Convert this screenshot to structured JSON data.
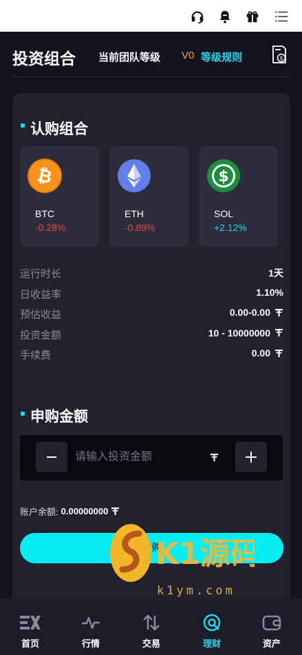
{
  "header": {
    "title": "投资组合",
    "level_label": "当前团队等级",
    "level_value": "V0",
    "rules_link": "等级规则"
  },
  "subscribe": {
    "section_title": "认购组合",
    "coins": [
      {
        "name": "BTC",
        "change": "-0.28%",
        "icon": "bitcoin-icon"
      },
      {
        "name": "ETH",
        "change": "-0.89%",
        "icon": "ethereum-icon"
      },
      {
        "name": "SOL",
        "change": "+2.12%",
        "icon": "dollar-coin-icon"
      }
    ]
  },
  "details": [
    {
      "label": "运行时长",
      "value": "1天",
      "unit_icon": false
    },
    {
      "label": "日收益率",
      "value": "1.10%",
      "unit_icon": false
    },
    {
      "label": "预估收益",
      "value": "0.00-0.00",
      "unit_icon": true
    },
    {
      "label": "投资金额",
      "value": "10 - 10000000",
      "unit_icon": true
    },
    {
      "label": "手续费",
      "value": "0.00",
      "unit_icon": true
    }
  ],
  "purchase": {
    "section_title": "申购金额",
    "input_placeholder": "请输入投资金额",
    "balance_label": "账户余额:",
    "balance_value": "0.00000000",
    "buy_label": "申购"
  },
  "watermark": {
    "brand": "K1源码",
    "domain": "k1ym.com"
  },
  "tabs": [
    {
      "label": "首页",
      "icon": "ex-logo-icon",
      "active": false
    },
    {
      "label": "行情",
      "icon": "pulse-icon",
      "active": false
    },
    {
      "label": "交易",
      "icon": "swap-arrows-icon",
      "active": false
    },
    {
      "label": "理财",
      "icon": "finance-icon",
      "active": true
    },
    {
      "label": "资产",
      "icon": "wallet-icon",
      "active": false
    }
  ],
  "colors": {
    "accent": "#27d4ec",
    "button": "#06eef4",
    "negative": "#e5494d",
    "level": "#f5a03a",
    "background": "#131320",
    "card": "#22222f"
  }
}
